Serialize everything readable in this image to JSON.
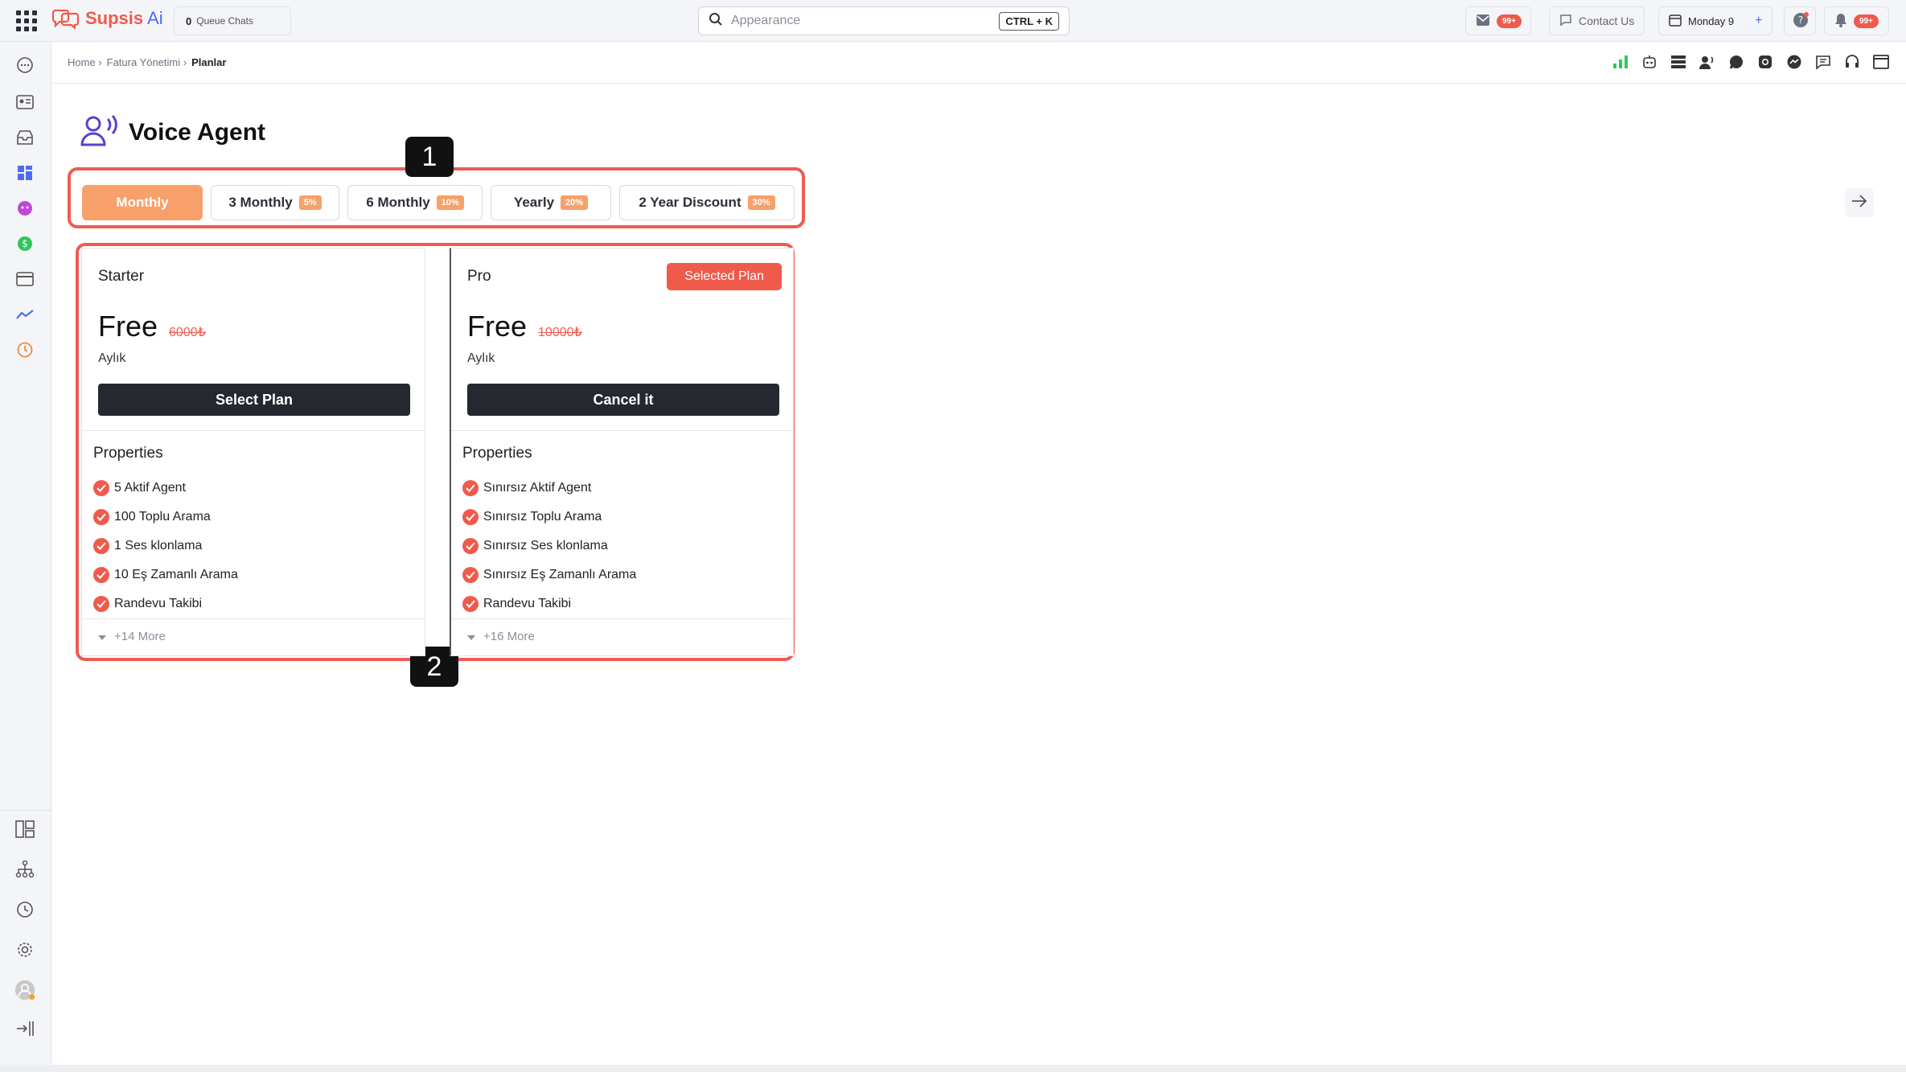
{
  "topbar": {
    "logo_text": "Supsis",
    "logo_ai": " Ai",
    "queue_count": "0",
    "queue_label": "Queue Chats",
    "search_placeholder": "Appearance",
    "search_shortcut": "CTRL + K",
    "mail_badge": "99+",
    "contact_label": "Contact Us",
    "date_label": "Monday 9",
    "notif_badge": "99+"
  },
  "breadcrumb": {
    "items": [
      "Home ›",
      "Fatura Yönetimi ›"
    ],
    "current": "Planlar"
  },
  "page": {
    "title": "Voice Agent"
  },
  "tabs": [
    {
      "label": "Monthly",
      "discount": ""
    },
    {
      "label": "3 Monthly",
      "discount": "5%"
    },
    {
      "label": "6 Monthly",
      "discount": "10%"
    },
    {
      "label": "Yearly",
      "discount": "20%"
    },
    {
      "label": "2 Year Discount",
      "discount": "30%"
    }
  ],
  "markers": [
    "1",
    "2"
  ],
  "plans": [
    {
      "name": "Starter",
      "price": "Free",
      "old_price": "6000₺",
      "period": "Aylık",
      "button": "Select Plan",
      "properties_title": "Properties",
      "features": [
        "5 Aktif Agent",
        "100 Toplu Arama",
        "1 Ses klonlama",
        "10 Eş Zamanlı Arama",
        "Randevu Takibi"
      ],
      "more": "+14 More"
    },
    {
      "name": "Pro",
      "price": "Free",
      "old_price": "10000₺",
      "period": "Aylık",
      "button": "Cancel it",
      "badge": "Selected Plan",
      "properties_title": "Properties",
      "features": [
        "Sınırsız Aktif Agent",
        "Sınırsız Toplu Arama",
        "Sınırsız Ses klonlama",
        "Sınırsız Eş Zamanlı Arama",
        "Randevu Takibi"
      ],
      "more": "+16 More"
    }
  ],
  "colors": {
    "accent": "#f05a4b",
    "tab_active": "#f7a06a",
    "button_dark": "#25282e",
    "highlight_box": "#ef5b52"
  }
}
